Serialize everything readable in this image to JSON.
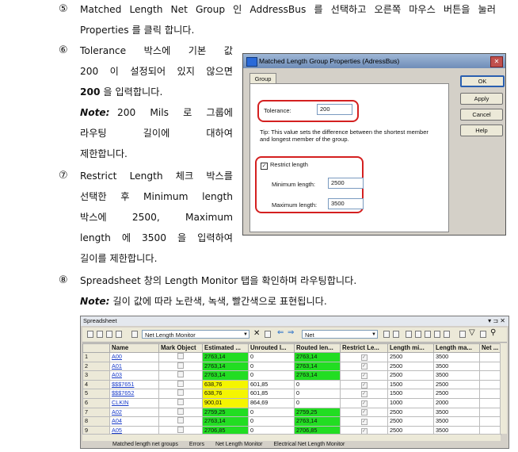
{
  "steps": {
    "s5": {
      "num": "⑤",
      "line1": [
        "Matched",
        "Length",
        "Net",
        "Group",
        "인",
        "AddressBus",
        "를",
        "선택하고",
        "오른쪽",
        "마우스",
        "버튼을",
        "눌러"
      ],
      "line2": "Properties 를 클릭 합니다."
    },
    "s6": {
      "num": "⑥",
      "line1": [
        "Tolerance",
        "박스에",
        "기본",
        "값"
      ],
      "line2": [
        "200",
        "이",
        "설정되어",
        "있지",
        "않으면"
      ],
      "line3": "200 을 입력합니다.",
      "line3_bold": "200",
      "line3_rest": " 을 입력합니다.",
      "note_label": "Note:",
      "note1": [
        "200",
        "Mils",
        "로",
        "그룹에"
      ],
      "note2": [
        "라우팅",
        "길이에",
        "대하여"
      ],
      "note3": "제한합니다."
    },
    "s7": {
      "num": "⑦",
      "line1": [
        "Restrict",
        "Length",
        "체크",
        "박스를"
      ],
      "line2": [
        "선택한",
        "후",
        "Minimum",
        "length"
      ],
      "line3": [
        "박스에",
        "2500,",
        "Maximum"
      ],
      "line4": [
        "length",
        "에",
        "3500",
        "을",
        "입력하여"
      ],
      "line5": "길이를 제한합니다."
    },
    "s8": {
      "num": "⑧",
      "line1": "Spreadsheet 창의 Length Monitor 탭을 확인하며 라우팅합니다.",
      "note_label": "Note:",
      "note": " 길이 값에 따라 노란색, 녹색, 빨간색으로 표현됩니다."
    }
  },
  "dialog": {
    "title": "Matched Length Group Properties (AdressBus)",
    "close": "✕",
    "tab": "Group",
    "buttons": {
      "ok": "OK",
      "apply": "Apply",
      "cancel": "Cancel",
      "help": "Help"
    },
    "tolerance_label": "Tolerance:",
    "tolerance_value": "200",
    "tip": "Tip: This value sets the difference between the shortest member",
    "tip2": "and longest member of the group.",
    "restrict_label": "Restrict length",
    "restrict_checked": "✓",
    "min_label": "Minimum length:",
    "min_value": "2500",
    "max_label": "Maximum length:",
    "max_value": "3500"
  },
  "spreadsheet": {
    "title": "Spreadsheet",
    "title_controls": "▾ ⊐ ✕",
    "view_combo": "Net Length Monitor",
    "net_combo": "Net",
    "headers": [
      "",
      "Name",
      "Mark Object",
      "Estimated ...",
      "Unrouted l...",
      "Routed len...",
      "Restrict Le...",
      "Length mi...",
      "Length ma...",
      "Net ..."
    ],
    "rows": [
      {
        "n": "1",
        "name": "A00",
        "est": "2763,14",
        "unr": "0",
        "rout": "2763,14",
        "min": "2500",
        "max": "3500",
        "estc": "g",
        "routc": "g"
      },
      {
        "n": "2",
        "name": "A01",
        "est": "2763,14",
        "unr": "0",
        "rout": "2763,14",
        "min": "2500",
        "max": "3500",
        "estc": "g",
        "routc": "g"
      },
      {
        "n": "3",
        "name": "A03",
        "est": "2763,14",
        "unr": "0",
        "rout": "2763,14",
        "min": "2500",
        "max": "3500",
        "estc": "g",
        "routc": "g"
      },
      {
        "n": "4",
        "name": "$$$7651",
        "est": "638,76",
        "unr": "601,85",
        "rout": "0",
        "min": "1500",
        "max": "2500",
        "estc": "y",
        "routc": ""
      },
      {
        "n": "5",
        "name": "$$$7652",
        "est": "638,76",
        "unr": "601,85",
        "rout": "0",
        "min": "1500",
        "max": "2500",
        "estc": "y",
        "routc": ""
      },
      {
        "n": "6",
        "name": "CLKIN",
        "est": "900,01",
        "unr": "864,69",
        "rout": "0",
        "min": "1000",
        "max": "2000",
        "estc": "y",
        "routc": ""
      },
      {
        "n": "7",
        "name": "A02",
        "est": "2759,25",
        "unr": "0",
        "rout": "2759,25",
        "min": "2500",
        "max": "3500",
        "estc": "g",
        "routc": "g"
      },
      {
        "n": "8",
        "name": "A04",
        "est": "2763,14",
        "unr": "0",
        "rout": "2763,14",
        "min": "2500",
        "max": "3500",
        "estc": "g",
        "routc": "g"
      },
      {
        "n": "9",
        "name": "A05",
        "est": "2706,85",
        "unr": "0",
        "rout": "2706,85",
        "min": "2500",
        "max": "3500",
        "estc": "g",
        "routc": "g"
      }
    ],
    "tabs": [
      "Matched length net groups",
      "Errors",
      "Net Length Monitor",
      "Electrical Net Length Monitor"
    ]
  }
}
